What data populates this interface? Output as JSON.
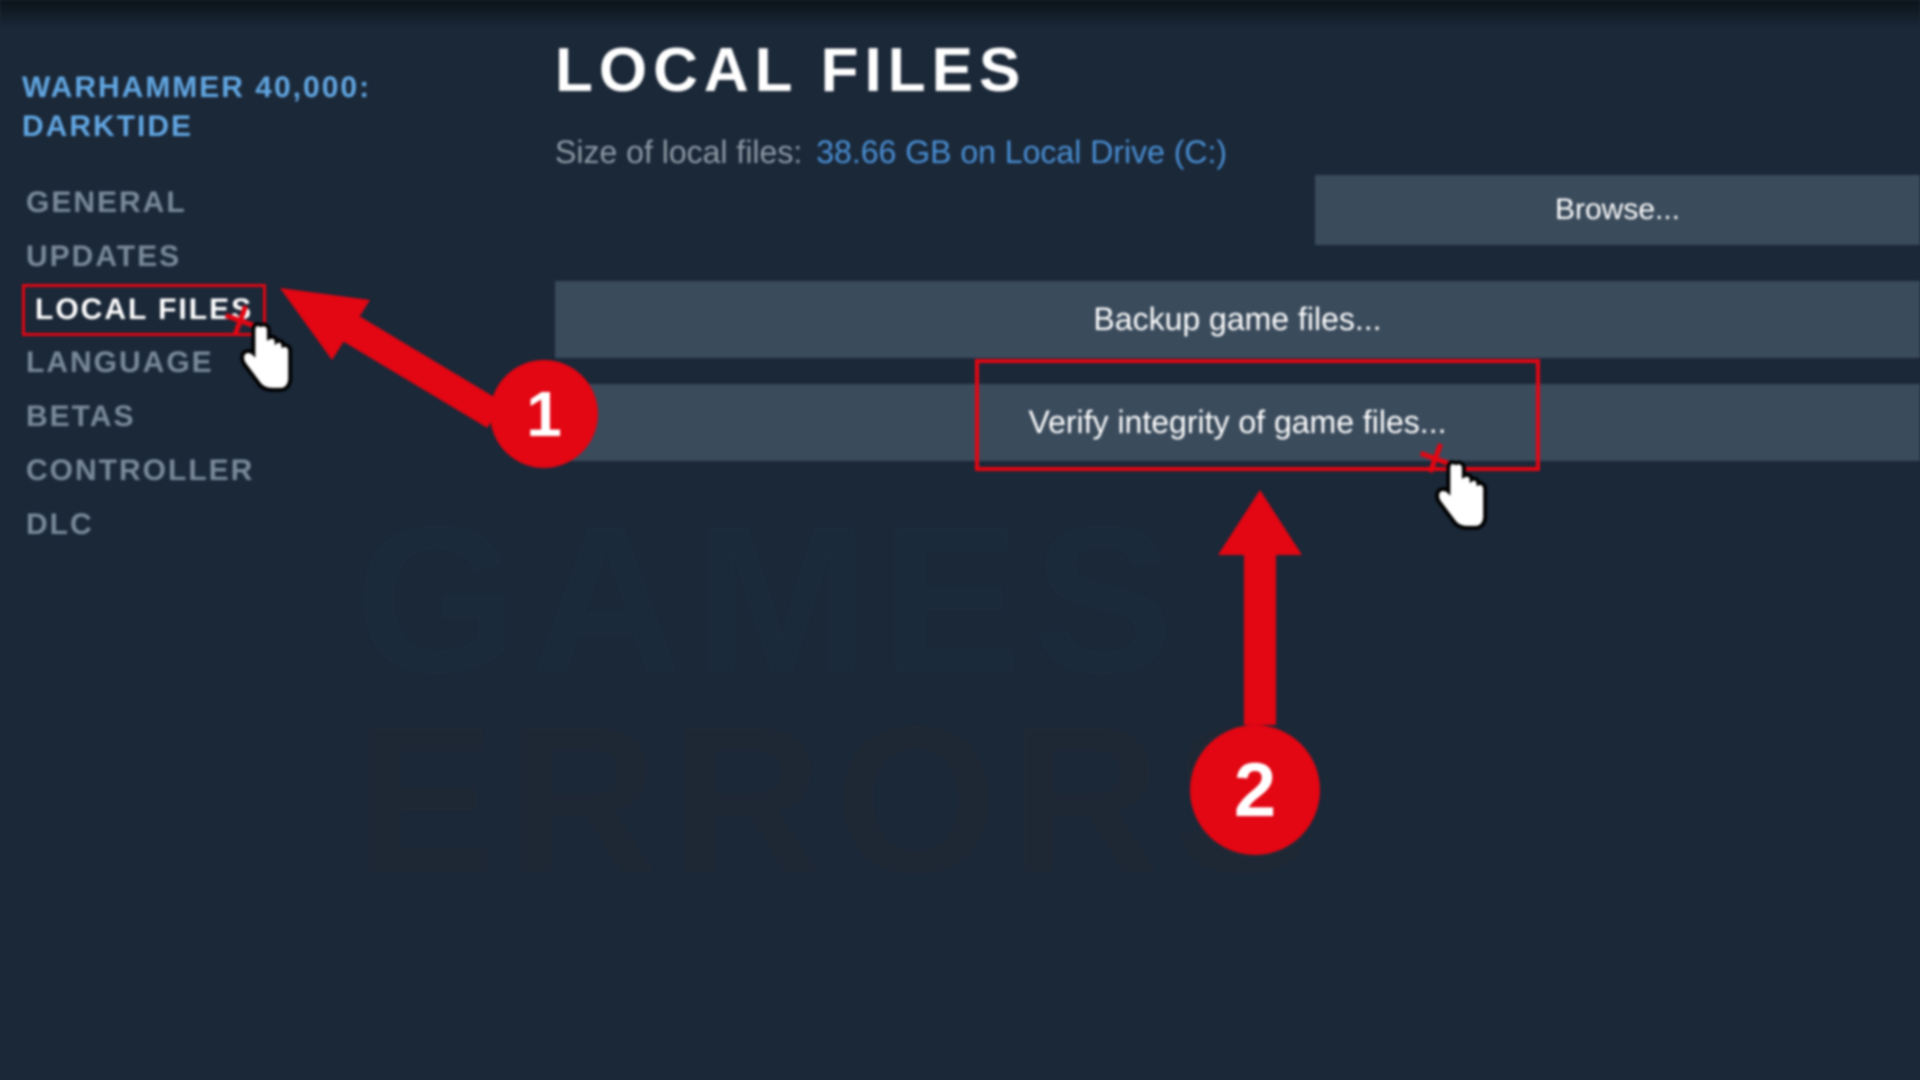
{
  "sidebar": {
    "game_title_line1": "WARHAMMER 40,000:",
    "game_title_line2": "DARKTIDE",
    "items": [
      {
        "label": "GENERAL"
      },
      {
        "label": "UPDATES"
      },
      {
        "label": "LOCAL FILES"
      },
      {
        "label": "LANGUAGE"
      },
      {
        "label": "BETAS"
      },
      {
        "label": "CONTROLLER"
      },
      {
        "label": "DLC"
      }
    ],
    "active_index": 2
  },
  "main": {
    "title": "LOCAL FILES",
    "size_label": "Size of local files:",
    "size_value": "38.66 GB on Local Drive (C:)",
    "browse_label": "Browse...",
    "backup_label": "Backup game files...",
    "verify_label": "Verify integrity of game files..."
  },
  "watermark": {
    "line1": "GAMES",
    "line2": "ERRORS"
  },
  "annotations": {
    "step1": "1",
    "step2": "2"
  }
}
